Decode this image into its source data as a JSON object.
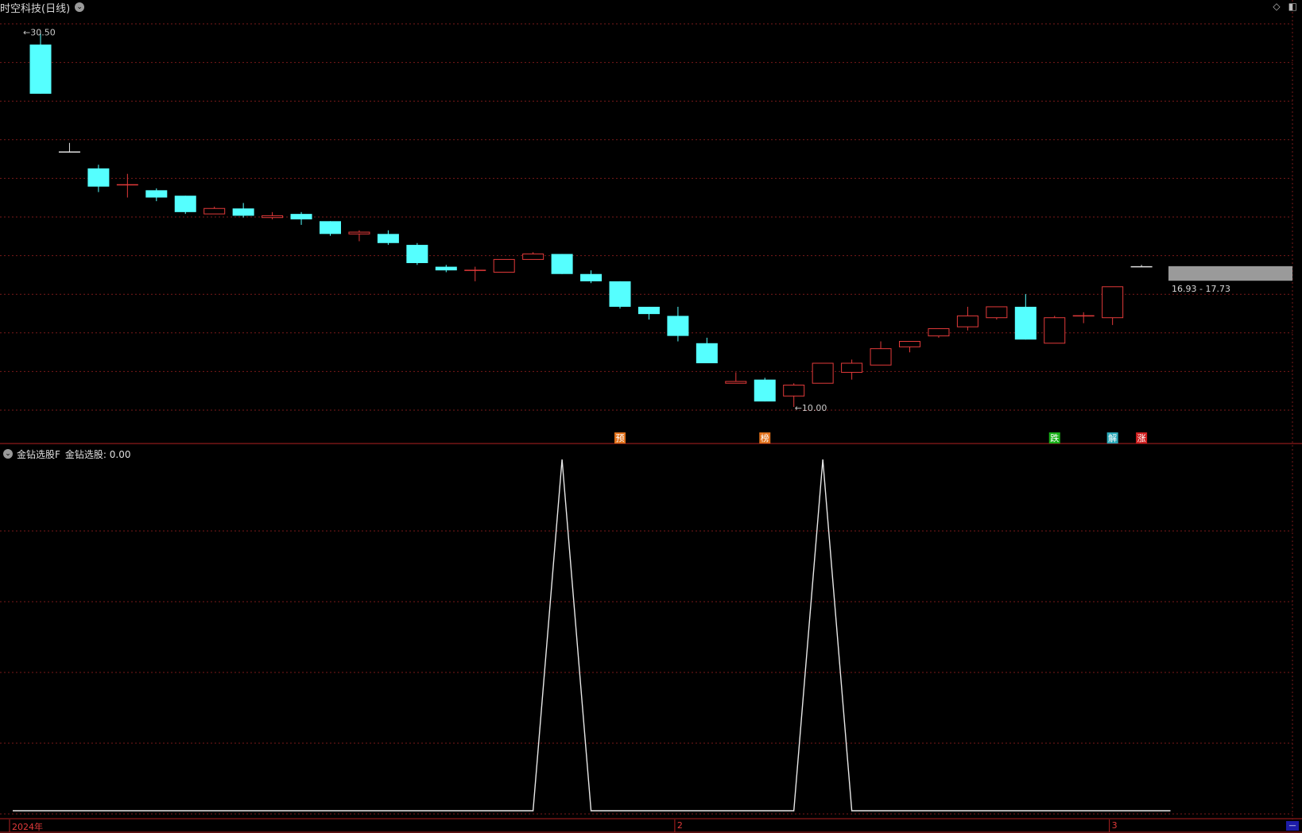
{
  "window": {
    "title": "时空科技(日线)",
    "icons": [
      "diamond-icon",
      "window-toggle-icon"
    ]
  },
  "colors": {
    "up": "#e23a3a",
    "down": "#55ffff",
    "grid": "#7a1a1a",
    "cross": "#e0e0e0",
    "indicator_line": "#e8e8e8",
    "range_band": "#9a9a9a"
  },
  "annotations": {
    "high_label": "30.50",
    "low_label": "10.00",
    "range_label": "16.93 - 17.73"
  },
  "event_markers": [
    {
      "index": 20,
      "text": "预",
      "color": "#e0701a"
    },
    {
      "index": 25,
      "text": "榜",
      "color": "#e0701a"
    },
    {
      "index": 35,
      "text": "跌",
      "color": "#18b018"
    },
    {
      "index": 37,
      "text": "解",
      "color": "#2aa8b8"
    },
    {
      "index": 38,
      "text": "涨",
      "color": "#d02020"
    }
  ],
  "indicator": {
    "name": "金钻选股F",
    "value_label": "金钻选股: 0.00"
  },
  "time_axis": {
    "labels": [
      {
        "text": "2024年",
        "index": 0
      },
      {
        "text": "2",
        "index": 22
      },
      {
        "text": "3",
        "index": 37
      }
    ]
  },
  "chart_data": [
    {
      "type": "candlestick",
      "title": "时空科技(日线)",
      "ylim": [
        9.3,
        31.3
      ],
      "grid": true,
      "candles": [
        {
          "o": 29.9,
          "h": 30.5,
          "l": 27.2,
          "c": 27.2
        },
        {
          "o": 24.0,
          "h": 24.5,
          "l": 24.0,
          "c": 24.0
        },
        {
          "o": 23.1,
          "h": 23.3,
          "l": 21.8,
          "c": 22.1
        },
        {
          "o": 22.2,
          "h": 22.8,
          "l": 21.5,
          "c": 22.2
        },
        {
          "o": 21.9,
          "h": 22.0,
          "l": 21.3,
          "c": 21.5
        },
        {
          "o": 21.6,
          "h": 21.6,
          "l": 20.6,
          "c": 20.7
        },
        {
          "o": 20.6,
          "h": 21.0,
          "l": 20.6,
          "c": 20.9
        },
        {
          "o": 20.9,
          "h": 21.2,
          "l": 20.4,
          "c": 20.5
        },
        {
          "o": 20.4,
          "h": 20.7,
          "l": 20.3,
          "c": 20.5
        },
        {
          "o": 20.6,
          "h": 20.7,
          "l": 20.0,
          "c": 20.3
        },
        {
          "o": 20.2,
          "h": 20.2,
          "l": 19.4,
          "c": 19.5
        },
        {
          "o": 19.5,
          "h": 19.7,
          "l": 19.1,
          "c": 19.6
        },
        {
          "o": 19.5,
          "h": 19.7,
          "l": 18.9,
          "c": 19.0
        },
        {
          "o": 18.9,
          "h": 19.0,
          "l": 17.8,
          "c": 17.9
        },
        {
          "o": 17.7,
          "h": 17.8,
          "l": 17.4,
          "c": 17.5
        },
        {
          "o": 17.5,
          "h": 17.7,
          "l": 16.9,
          "c": 17.5
        },
        {
          "o": 17.4,
          "h": 18.1,
          "l": 17.4,
          "c": 18.1
        },
        {
          "o": 18.1,
          "h": 18.5,
          "l": 18.1,
          "c": 18.4
        },
        {
          "o": 18.4,
          "h": 18.4,
          "l": 17.3,
          "c": 17.3
        },
        {
          "o": 17.3,
          "h": 17.5,
          "l": 16.8,
          "c": 16.9
        },
        {
          "o": 16.9,
          "h": 16.9,
          "l": 15.4,
          "c": 15.5
        },
        {
          "o": 15.5,
          "h": 15.5,
          "l": 14.8,
          "c": 15.1
        },
        {
          "o": 15.0,
          "h": 15.5,
          "l": 13.6,
          "c": 13.9
        },
        {
          "o": 13.5,
          "h": 13.8,
          "l": 12.4,
          "c": 12.4
        },
        {
          "o": 11.3,
          "h": 11.9,
          "l": 11.3,
          "c": 11.4
        },
        {
          "o": 11.5,
          "h": 11.6,
          "l": 10.3,
          "c": 10.3
        },
        {
          "o": 10.6,
          "h": 11.3,
          "l": 10.0,
          "c": 11.2
        },
        {
          "o": 11.3,
          "h": 12.4,
          "l": 11.3,
          "c": 12.4
        },
        {
          "o": 11.9,
          "h": 12.6,
          "l": 11.5,
          "c": 12.4
        },
        {
          "o": 12.3,
          "h": 13.6,
          "l": 12.3,
          "c": 13.2
        },
        {
          "o": 13.3,
          "h": 13.6,
          "l": 13.0,
          "c": 13.6
        },
        {
          "o": 13.9,
          "h": 14.3,
          "l": 13.8,
          "c": 14.3
        },
        {
          "o": 14.4,
          "h": 15.5,
          "l": 14.2,
          "c": 15.0
        },
        {
          "o": 14.9,
          "h": 15.5,
          "l": 14.8,
          "c": 15.5
        },
        {
          "o": 15.5,
          "h": 16.2,
          "l": 13.7,
          "c": 13.7
        },
        {
          "o": 13.5,
          "h": 15.0,
          "l": 13.5,
          "c": 14.9
        },
        {
          "o": 15.0,
          "h": 15.2,
          "l": 14.6,
          "c": 15.0
        },
        {
          "o": 14.9,
          "h": 16.6,
          "l": 14.5,
          "c": 16.6
        },
        {
          "o": 17.7,
          "h": 17.8,
          "l": 17.7,
          "c": 17.7
        }
      ],
      "range_band": {
        "low": 16.93,
        "high": 17.73
      }
    },
    {
      "type": "line",
      "title": "金钻选股F",
      "ylim": [
        0,
        1
      ],
      "series": [
        {
          "name": "金钻选股",
          "values": [
            0,
            0,
            0,
            0,
            0,
            0,
            0,
            0,
            0,
            0,
            0,
            0,
            0,
            0,
            0,
            0,
            0,
            0,
            1,
            0,
            0,
            0,
            0,
            0,
            0,
            0,
            0,
            1,
            0,
            0,
            0,
            0,
            0,
            0,
            0,
            0,
            0,
            0,
            0,
            0
          ]
        }
      ]
    }
  ]
}
